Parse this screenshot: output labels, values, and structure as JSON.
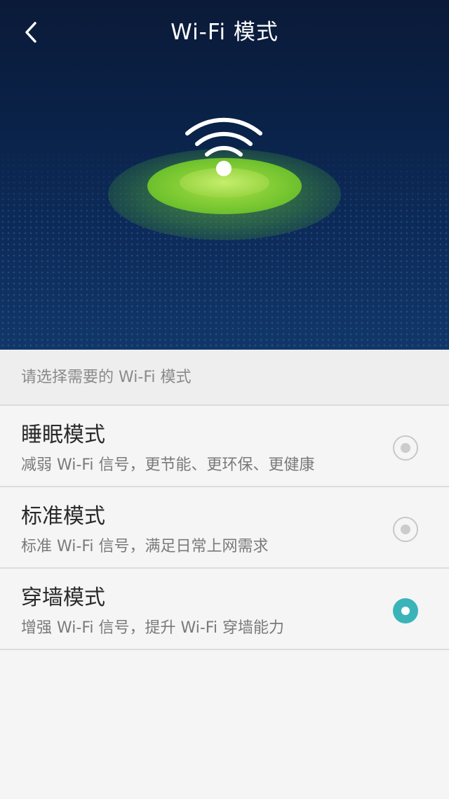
{
  "header": {
    "title": "Wi-Fi 模式",
    "back_icon": "chevron-left-icon"
  },
  "hero": {
    "icon": "wifi-signal-icon"
  },
  "prompt": {
    "text": "请选择需要的 Wi-Fi 模式"
  },
  "modes": [
    {
      "title": "睡眠模式",
      "description": "减弱 Wi-Fi 信号，更节能、更环保、更健康",
      "selected": false
    },
    {
      "title": "标准模式",
      "description": "标准 Wi-Fi 信号，满足日常上网需求",
      "selected": false
    },
    {
      "title": "穿墙模式",
      "description": "增强 Wi-Fi 信号，提升 Wi-Fi 穿墙能力",
      "selected": true
    }
  ],
  "colors": {
    "accent": "#3ab4b8",
    "hero_bg": "#0d2c5c",
    "signal_green": "#8ed63a"
  }
}
